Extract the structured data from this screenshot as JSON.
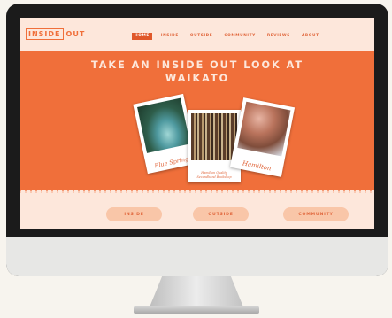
{
  "site": {
    "logo_inside": "INSIDE",
    "logo_out": "OUT"
  },
  "nav": {
    "items": [
      {
        "label": "HOME",
        "active": true
      },
      {
        "label": "INSIDE",
        "active": false
      },
      {
        "label": "OUTSIDE",
        "active": false
      },
      {
        "label": "COMMUNITY",
        "active": false
      },
      {
        "label": "REVIEWS",
        "active": false
      },
      {
        "label": "ABOUT",
        "active": false
      }
    ]
  },
  "hero": {
    "title_line1": "TAKE AN INSIDE OUT LOOK AT",
    "title_line2": "WAIKATO",
    "photos": [
      {
        "caption": "Blue Spring",
        "image": "blue-spring-photo"
      },
      {
        "caption_line1": "Hamilton Quality",
        "caption_line2": "Secondhand Bookshop",
        "image": "bookshop-photo"
      },
      {
        "caption": "Hamilton",
        "image": "hamilton-photo"
      }
    ]
  },
  "categories": [
    "INSIDE",
    "OUTSIDE",
    "COMMUNITY"
  ],
  "colors": {
    "accent": "#f06f3a",
    "cream": "#fde7db",
    "pill": "#f9c6a8"
  }
}
